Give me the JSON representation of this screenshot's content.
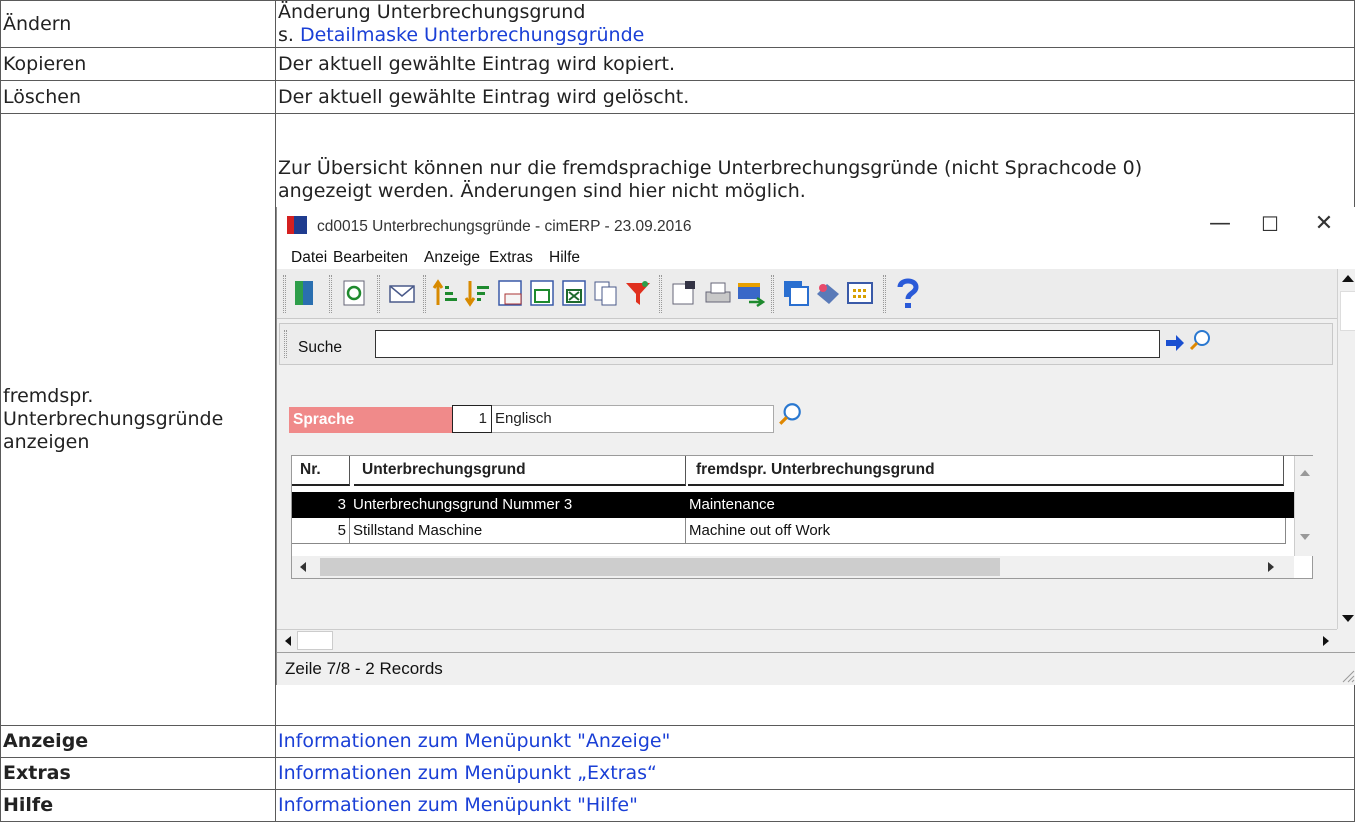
{
  "rows": {
    "aendern": {
      "label": "Ändern",
      "desc": "Änderung Unterbrechungsgrund",
      "prefix": "s. ",
      "link": "Detailmaske Unterbrechungsgründe"
    },
    "kopieren": {
      "label": "Kopieren",
      "desc": "Der aktuell gewählte Eintrag wird kopiert."
    },
    "loeschen": {
      "label": "Löschen",
      "desc": "Der aktuell gewählte Eintrag wird gelöscht."
    },
    "fremd": {
      "label_l1": "fremdspr.",
      "label_l2": "Unterbrechungsgründe",
      "label_l3": "anzeigen",
      "desc_l1": "Zur Übersicht können nur die fremdsprachige Unterbrechungsgründe (nicht Sprachcode 0)",
      "desc_l2": "angezeigt werden. Änderungen sind hier nicht möglich."
    },
    "anzeige": {
      "label": "Anzeige",
      "link": "Informationen zum Menüpunkt \"Anzeige\""
    },
    "extras": {
      "label": "Extras",
      "link": "Informationen zum Menüpunkt „Extras“"
    },
    "hilfe": {
      "label": "Hilfe",
      "link": "Informationen zum Menüpunkt \"Hilfe\""
    }
  },
  "window": {
    "title": "cd0015 Unterbrechungsgründe - cimERP - 23.09.2016",
    "controls": {
      "minimize": "—",
      "maximize": "☐",
      "close": "✕"
    },
    "menu": [
      "Datei",
      "Bearbeiten",
      "Anzeige",
      "Extras",
      "Hilfe"
    ],
    "search_label": "Suche",
    "search_value": "",
    "sprache_label": "Sprache",
    "sprache_code": "1",
    "sprache_name": "Englisch",
    "grid": {
      "columns": [
        "Nr.",
        "Unterbrechungsgrund",
        "fremdspr. Unterbrechungsgrund"
      ],
      "rows": [
        {
          "nr": "3",
          "grund": "Unterbrechungsgrund Nummer 3",
          "fremd": "Maintenance"
        },
        {
          "nr": "5",
          "grund": "Stillstand Maschine",
          "fremd": "Machine out off Work"
        }
      ]
    },
    "status": "Zeile 7/8 - 2 Records",
    "icons": [
      "exit-door-icon",
      "refresh-icon",
      "mail-icon",
      "sort-ascending-icon",
      "sort-descending-icon",
      "calendar-123-icon",
      "export-icon",
      "excel-icon",
      "copy-pages-icon",
      "filter-icon",
      "form-icon",
      "printer-icon",
      "transfer-icon",
      "windows-icon",
      "stamp-icon",
      "columns-icon",
      "help-icon"
    ],
    "colors": {
      "sprache_bg": "#f08a8a",
      "selected_row": "#000000",
      "link": "#1a3fd6"
    }
  }
}
